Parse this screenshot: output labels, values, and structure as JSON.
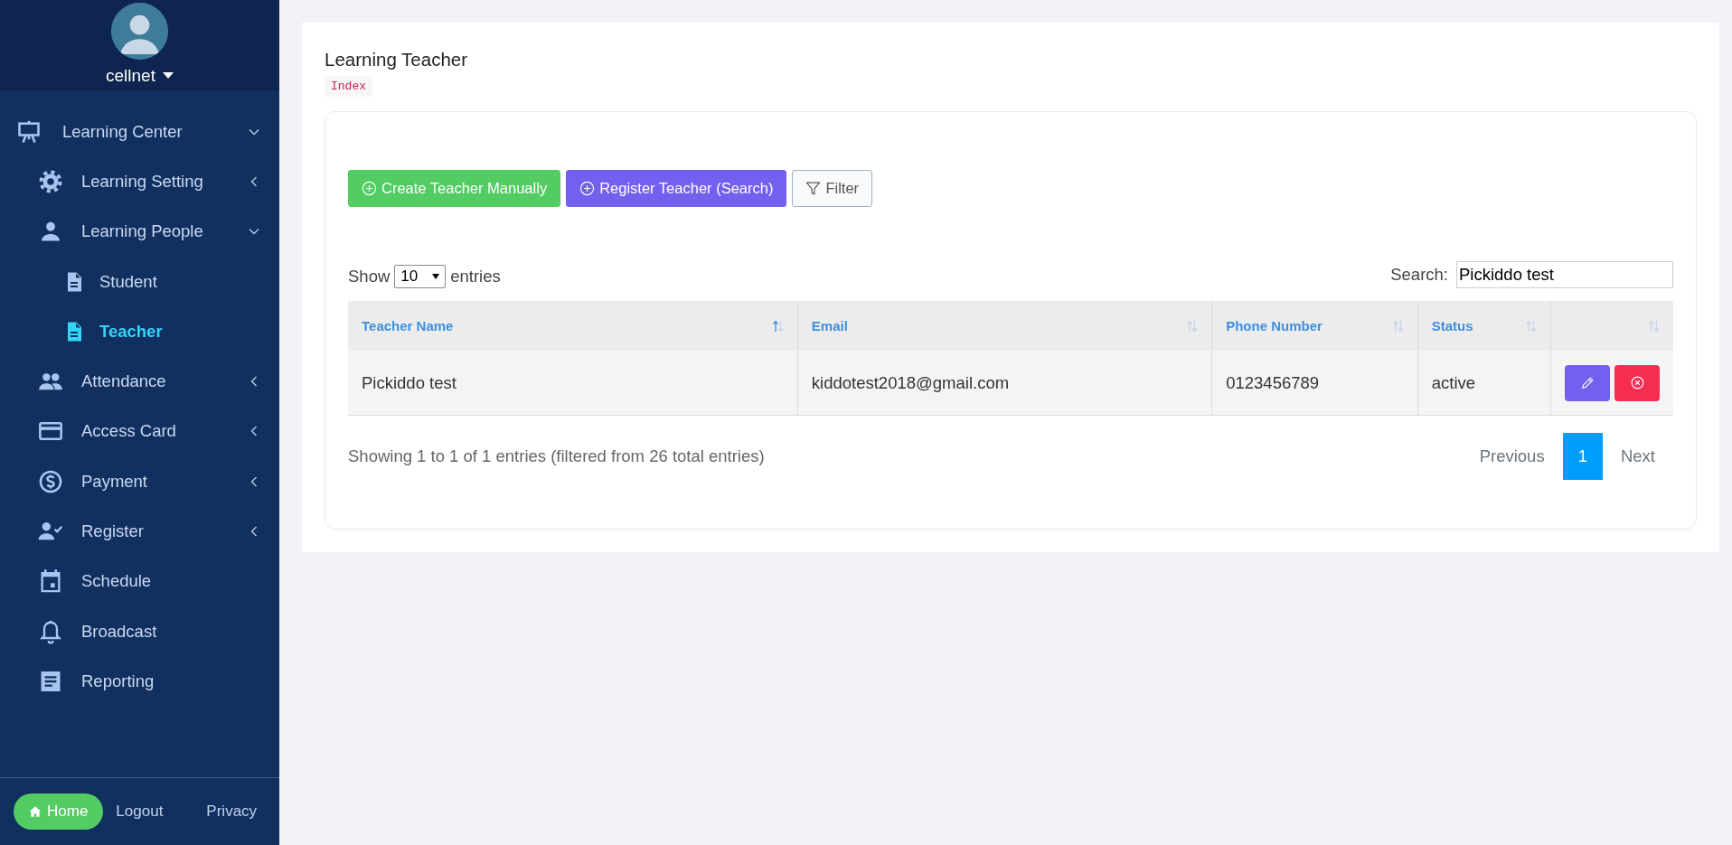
{
  "sidebar": {
    "user": {
      "name": "cellnet"
    },
    "nav": [
      {
        "label": "Learning Center",
        "kind": "group",
        "expanded": true,
        "selected": false,
        "children": [
          {
            "label": "Learning Setting",
            "kind": "group",
            "expanded": false,
            "selected": false
          },
          {
            "label": "Learning People",
            "kind": "group",
            "expanded": true,
            "selected": false,
            "children": [
              {
                "label": "Student",
                "selected": false
              },
              {
                "label": "Teacher",
                "selected": true
              }
            ]
          },
          {
            "label": "Attendance",
            "kind": "group",
            "expanded": false,
            "selected": false
          },
          {
            "label": "Access Card",
            "kind": "group",
            "expanded": false,
            "selected": false
          },
          {
            "label": "Payment",
            "kind": "group",
            "expanded": false,
            "selected": false
          },
          {
            "label": "Register",
            "kind": "group",
            "expanded": false,
            "selected": false
          },
          {
            "label": "Schedule",
            "selected": false
          },
          {
            "label": "Broadcast",
            "selected": false
          },
          {
            "label": "Reporting",
            "selected": false
          }
        ]
      }
    ],
    "footer": {
      "home": "Home",
      "links": [
        "Logout",
        "Privacy"
      ]
    }
  },
  "page": {
    "title": "Learning Teacher",
    "breadcrumb": "Index",
    "actions": [
      {
        "label": "Create Teacher Manually",
        "kind": "create"
      },
      {
        "label": "Register Teacher (Search)",
        "kind": "register"
      },
      {
        "label": "Filter",
        "kind": "filter"
      }
    ],
    "length": {
      "before": "Show",
      "value": "10",
      "after": "entries"
    },
    "search": {
      "label": "Search:",
      "value": "Pickiddo test"
    },
    "table": {
      "columns": [
        {
          "label": "Teacher Name",
          "sorted": true
        },
        {
          "label": "Email",
          "sorted": false
        },
        {
          "label": "Phone Number",
          "sorted": false
        },
        {
          "label": "Status",
          "sorted": false
        },
        {
          "sorted": false
        }
      ],
      "rows": [
        {
          "cells": [
            "Pickiddo test",
            "kiddotest2018@gmail.com",
            "0123456789",
            "active"
          ],
          "actions": [
            {
              "kind": "edit"
            },
            {
              "kind": "delete"
            }
          ]
        }
      ]
    },
    "info": "Showing 1 to 1 of 1 entries (filtered from 26 total entries)",
    "pagination": {
      "previous": "Previous",
      "pages": [
        {
          "label": "1",
          "selected": true
        }
      ],
      "next": "Next"
    }
  }
}
